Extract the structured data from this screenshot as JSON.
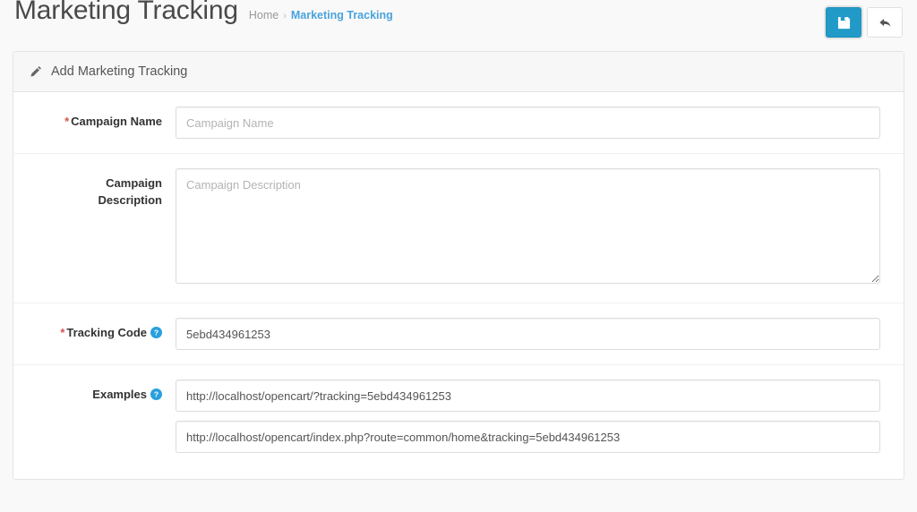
{
  "header": {
    "title": "Marketing Tracking",
    "breadcrumb": {
      "home": "Home",
      "separator": "›",
      "current": "Marketing Tracking"
    },
    "actions": {
      "save_title": "Save",
      "back_title": "Back"
    }
  },
  "panel": {
    "title": "Add Marketing Tracking"
  },
  "form": {
    "campaign_name": {
      "label": "Campaign Name",
      "required_marker": "*",
      "placeholder": "Campaign Name",
      "value": ""
    },
    "campaign_description": {
      "label_line1": "Campaign",
      "label_line2": "Description",
      "placeholder": "Campaign Description",
      "value": ""
    },
    "tracking_code": {
      "label": "Tracking Code",
      "required_marker": "*",
      "value": "5ebd434961253"
    },
    "examples": {
      "label": "Examples",
      "url1": "http://localhost/opencart/?tracking=5ebd434961253",
      "url2": "http://localhost/opencart/index.php?route=common/home&tracking=5ebd434961253"
    }
  },
  "colors": {
    "primary": "#229ac8",
    "link": "#4aa3df",
    "required": "#d9534f",
    "help": "#29a0dd",
    "page_bg": "#f9f9f9"
  }
}
